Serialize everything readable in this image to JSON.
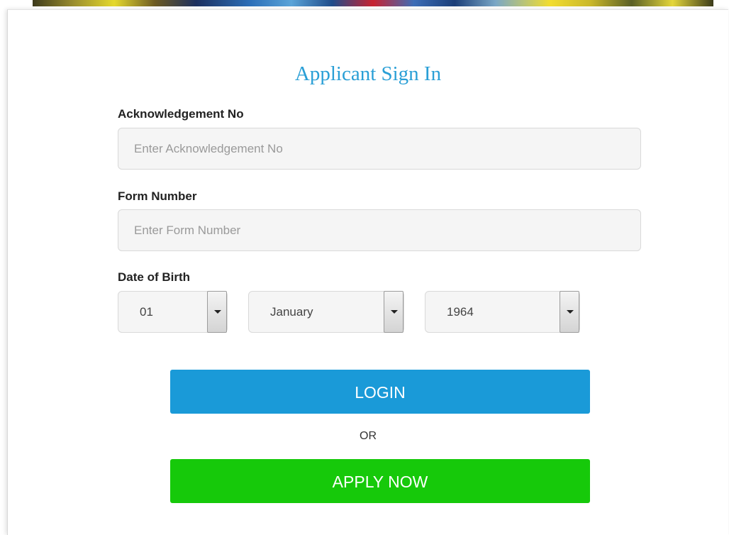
{
  "page": {
    "title": "Applicant Sign In"
  },
  "form": {
    "ack_label": "Acknowledgement No",
    "ack_placeholder": "Enter Acknowledgement No",
    "ack_value": "",
    "form_label": "Form Number",
    "form_placeholder": "Enter Form Number",
    "form_value": "",
    "dob_label": "Date of Birth",
    "dob_day": "01",
    "dob_month": "January",
    "dob_year": "1964"
  },
  "actions": {
    "login_label": "LOGIN",
    "or_label": "OR",
    "apply_label": "APPLY NOW"
  },
  "colors": {
    "title": "#2a9fd6",
    "login_button": "#1a9ad8",
    "apply_button": "#16c90a"
  },
  "icons": {
    "select_arrow": "chevron-down-icon"
  }
}
